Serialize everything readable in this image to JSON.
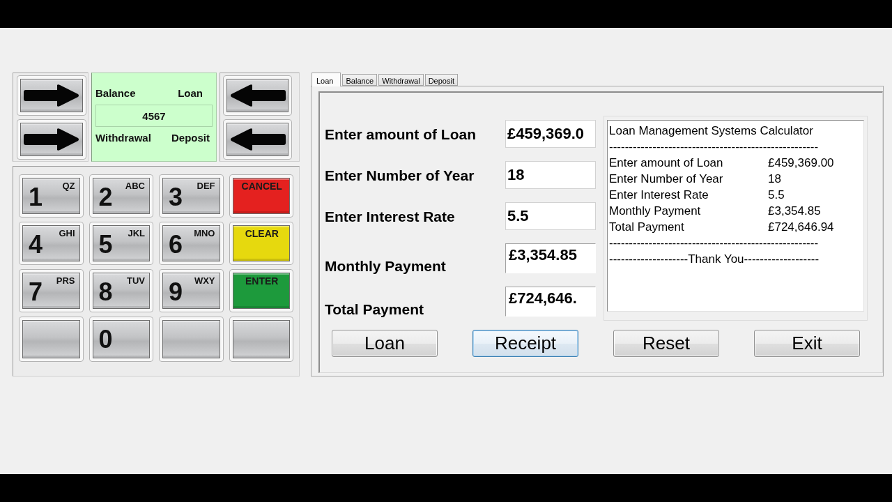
{
  "display": {
    "options_top": [
      "Balance",
      "Loan"
    ],
    "value": "4567",
    "options_bottom": [
      "Withdrawal",
      "Deposit"
    ]
  },
  "keypad": [
    {
      "kind": "digit",
      "digit": "1",
      "letters": "QZ"
    },
    {
      "kind": "digit",
      "digit": "2",
      "letters": "ABC"
    },
    {
      "kind": "digit",
      "digit": "3",
      "letters": "DEF"
    },
    {
      "kind": "function",
      "label": "CANCEL",
      "color": "#e4211f"
    },
    {
      "kind": "digit",
      "digit": "4",
      "letters": "GHI"
    },
    {
      "kind": "digit",
      "digit": "5",
      "letters": "JKL"
    },
    {
      "kind": "digit",
      "digit": "6",
      "letters": "MNO"
    },
    {
      "kind": "function",
      "label": "CLEAR",
      "color": "#e6d90e"
    },
    {
      "kind": "digit",
      "digit": "7",
      "letters": "PRS"
    },
    {
      "kind": "digit",
      "digit": "8",
      "letters": "TUV"
    },
    {
      "kind": "digit",
      "digit": "9",
      "letters": "WXY"
    },
    {
      "kind": "function",
      "label": "ENTER",
      "color": "#1d9a3c"
    },
    {
      "kind": "blank"
    },
    {
      "kind": "digit",
      "digit": "0"
    },
    {
      "kind": "blank"
    },
    {
      "kind": "blank"
    }
  ],
  "tabs": [
    {
      "label": "Loan",
      "selected": true
    },
    {
      "label": "Balance",
      "selected": false
    },
    {
      "label": "Withdrawal",
      "selected": false
    },
    {
      "label": "Deposit",
      "selected": false
    }
  ],
  "form": {
    "fields": [
      {
        "kind": "input",
        "label": "Enter amount of Loan",
        "value": "£459,369.0"
      },
      {
        "kind": "input",
        "label": "Enter Number of Year",
        "value": "18"
      },
      {
        "kind": "input",
        "label": "Enter Interest Rate",
        "value": "5.5"
      },
      {
        "kind": "output",
        "label": "Monthly Payment",
        "value": "£3,354.85"
      },
      {
        "kind": "output",
        "label": "Total Payment",
        "value": "£724,646."
      }
    ]
  },
  "receipt": {
    "title": "Loan Management Systems Calculator",
    "rule_top": "-----------------------------------------------------",
    "lines": [
      {
        "label": "Enter amount of Loan",
        "value": "£459,369.00"
      },
      {
        "label": "Enter Number of Year",
        "value": "18"
      },
      {
        "label": "Enter Interest Rate",
        "value": "5.5"
      },
      {
        "label": "Monthly Payment",
        "value": "£3,354.85"
      },
      {
        "label": "Total Payment",
        "value": "£724,646.94"
      }
    ],
    "rule_bottom": "-----------------------------------------------------",
    "footer": "--------------------Thank You-------------------"
  },
  "buttons": [
    {
      "label": "Loan",
      "focused": false
    },
    {
      "label": "Receipt",
      "focused": true
    },
    {
      "label": "Reset",
      "focused": false
    },
    {
      "label": "Exit",
      "focused": false
    }
  ]
}
